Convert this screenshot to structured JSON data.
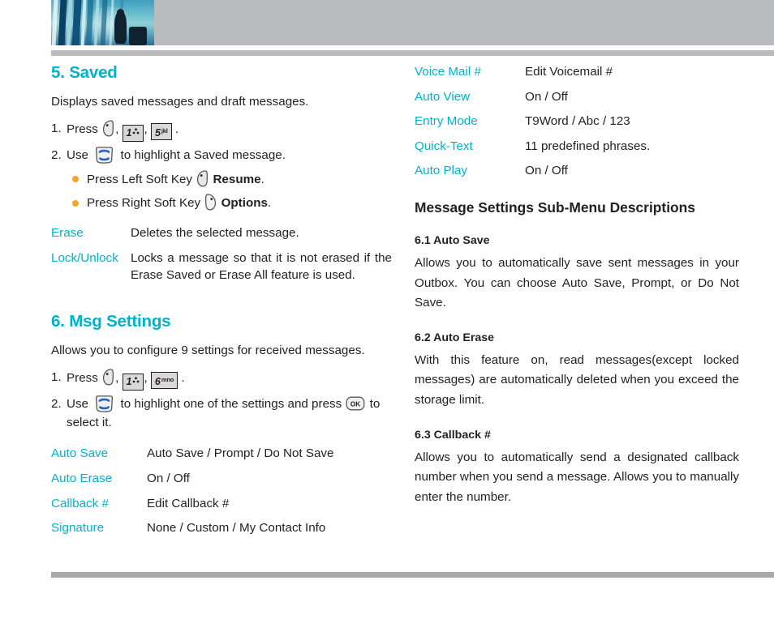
{
  "colors": {
    "accent_teal": "#00b3cc",
    "bullet_amber": "#f5a623",
    "rule_gray": "#b9bbbf",
    "text": "#231f20"
  },
  "header": {
    "photo_alt": "blue-toned photo of a traveler walking past glass pillars"
  },
  "left_column": {
    "section_saved": {
      "title": "5. Saved",
      "lead": "Displays saved messages and draft messages.",
      "steps": [
        {
          "num": "1.",
          "pre": "Press",
          "keys": [
            "softkey-left",
            "key-1",
            "key-5"
          ],
          "post": "."
        },
        {
          "num": "2.",
          "pre": "Use",
          "keys": [
            "nav-key"
          ],
          "post": "to highlight a Saved message."
        }
      ],
      "bullets": [
        {
          "text": "Press Left Soft Key",
          "key": "softkey-left",
          "bold": "Resume",
          "post": "."
        },
        {
          "text": "Press Right Soft Key",
          "key": "softkey-right",
          "bold": "Options",
          "post": "."
        }
      ],
      "definitions": [
        {
          "term": "Erase",
          "desc": "Deletes the selected message."
        },
        {
          "term": "Lock/Unlock",
          "desc": "Locks a message so that it is not erased if the Erase Saved or Erase All feature is used."
        }
      ]
    },
    "section_msg_settings": {
      "title": "6. Msg Settings",
      "lead": "Allows you to configure 9 settings for received messages.",
      "steps": [
        {
          "num": "1.",
          "pre": "Press",
          "keys": [
            "softkey-left",
            "key-1",
            "key-6"
          ],
          "post": "."
        },
        {
          "num": "2.",
          "pre": "Use",
          "keys": [
            "nav-key"
          ],
          "mid": "to highlight one of the settings and press",
          "key2": "ok-key",
          "post": "to select it."
        }
      ],
      "settings": [
        {
          "term": "Auto Save",
          "desc": "Auto Save / Prompt / Do Not Save"
        },
        {
          "term": "Auto Erase",
          "desc": "On / Off"
        },
        {
          "term": "Callback #",
          "desc": "Edit Callback #"
        },
        {
          "term": "Signature",
          "desc": "None / Custom / My Contact Info"
        }
      ]
    }
  },
  "right_column": {
    "settings_continued": [
      {
        "term": "Voice Mail #",
        "desc": "Edit Voicemail #"
      },
      {
        "term": "Auto View",
        "desc": "On / Off"
      },
      {
        "term": "Entry Mode",
        "desc": "T9Word / Abc / 123"
      },
      {
        "term": "Quick-Text",
        "desc": "11 predefined phrases."
      },
      {
        "term": "Auto Play",
        "desc": "On / Off"
      }
    ],
    "sub_menu_heading": "Message Settings Sub-Menu Descriptions",
    "items": [
      {
        "heading": "6.1 Auto Save",
        "body": "Allows you to automatically save sent messages in your Outbox. You can choose Auto Save, Prompt, or Do Not Save."
      },
      {
        "heading": "6.2 Auto Erase",
        "body": "With this feature on, read messages(except locked messages) are automatically deleted when you exceed the storage limit."
      },
      {
        "heading": "6.3 Callback #",
        "body": "Allows you to automatically send a designated callback number when you send a message. Allows you to manually enter the number."
      }
    ]
  },
  "keycaps": {
    "key_1_label": "1",
    "key_5_label": "5",
    "key_5_sup": "jkl",
    "key_6_label": "6",
    "key_6_sup": "mno",
    "ok_label": "OK"
  }
}
